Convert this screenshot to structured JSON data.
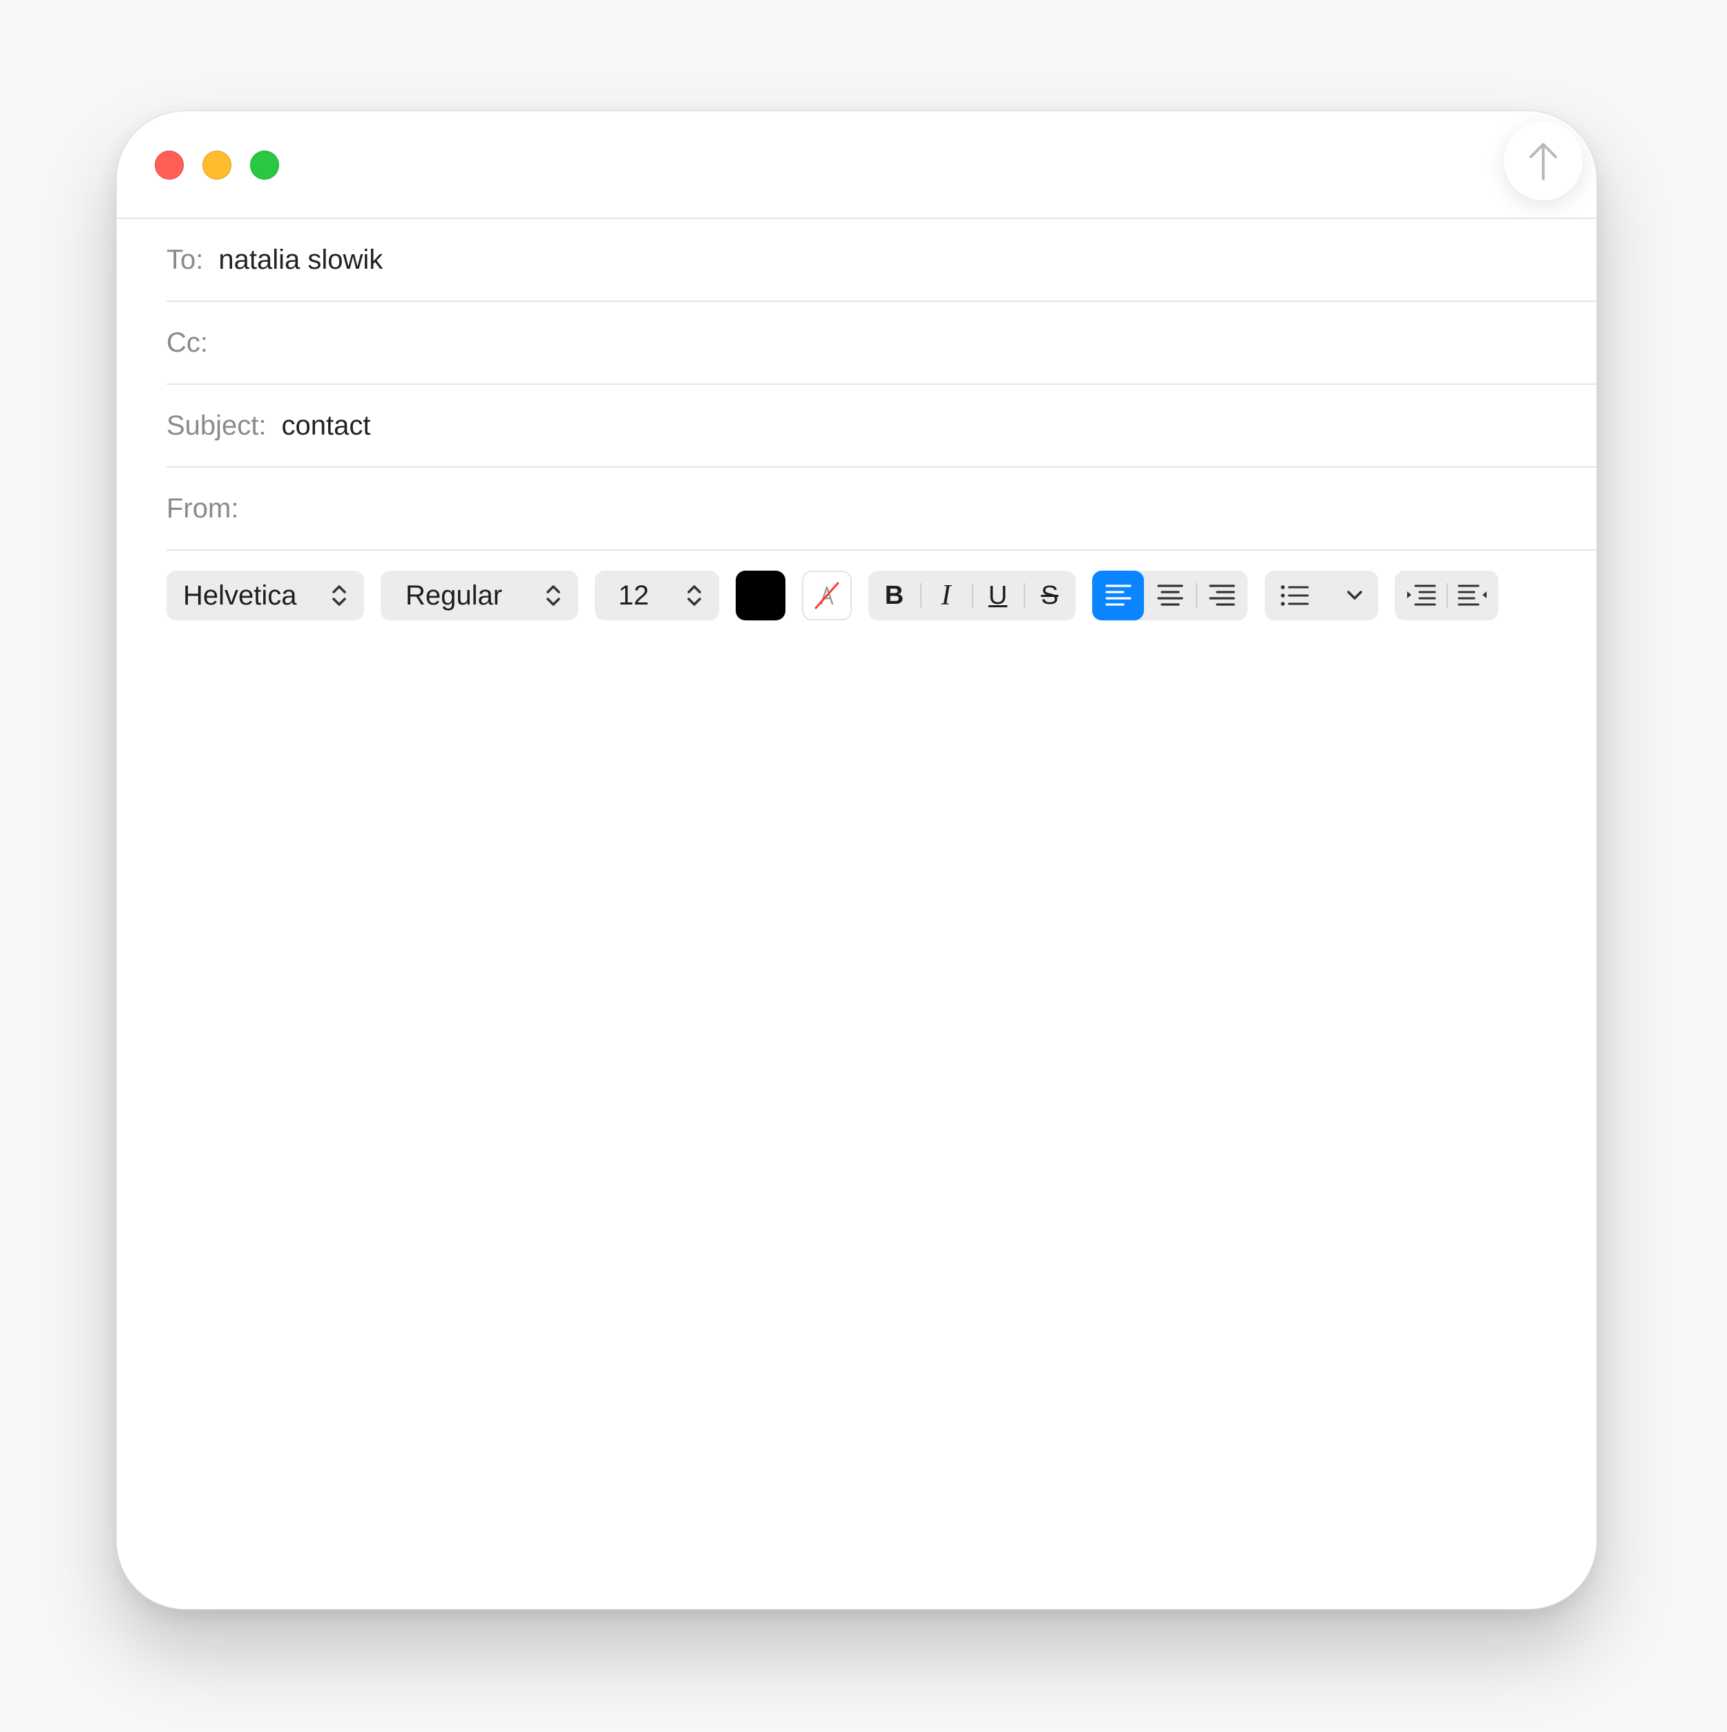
{
  "window": {
    "controls": [
      "close",
      "minimize",
      "zoom"
    ]
  },
  "toolbar_top": {
    "send_icon": "arrow-up-icon"
  },
  "header_fields": {
    "to": {
      "label": "To:",
      "value": "natalia slowik"
    },
    "cc": {
      "label": "Cc:",
      "value": ""
    },
    "subject": {
      "label": "Subject:",
      "value": "contact"
    },
    "from": {
      "label": "From:",
      "value": ""
    }
  },
  "format_bar": {
    "font_family": "Helvetica",
    "font_style": "Regular",
    "font_size": "12",
    "text_color": "#000000",
    "bold_label": "B",
    "italic_label": "I",
    "underline_label": "U",
    "strike_label": "S",
    "alignment_selected": "left",
    "accent_color": "#0a84ff"
  },
  "body": {
    "text": ""
  }
}
